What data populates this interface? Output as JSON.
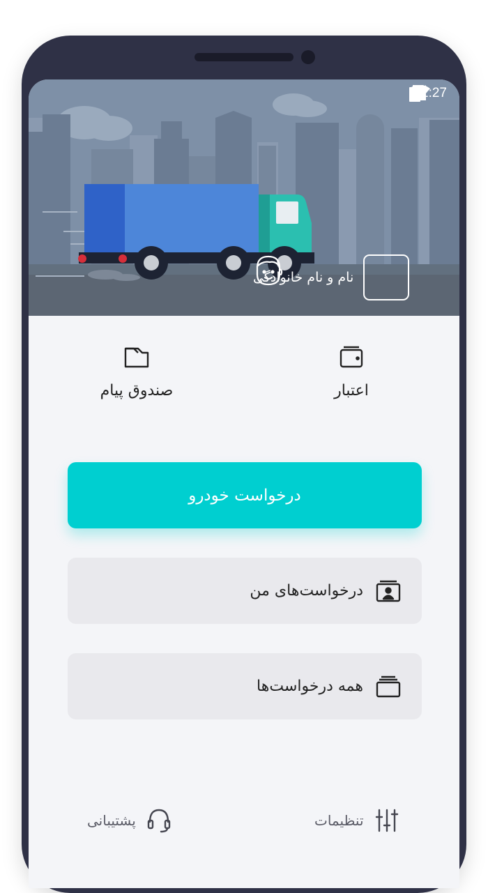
{
  "status_bar": {
    "time": "12:27",
    "icons": [
      "wifi-icon",
      "signal-icon",
      "battery-icon"
    ]
  },
  "profile": {
    "name": "نام و نام خانوادگی",
    "avatar_icon": "face-icon"
  },
  "quick_actions": {
    "inbox": {
      "label": "صندوق پیام",
      "icon": "folder-icon"
    },
    "credit": {
      "label": "اعتبار",
      "icon": "wallet-icon"
    }
  },
  "actions": {
    "request_vehicle": "درخواست خودرو",
    "my_requests": "درخواست‌های من",
    "all_requests": "همه درخواست‌ها"
  },
  "bottom_bar": {
    "support": "پشتیبانی",
    "settings": "تنظیمات"
  },
  "colors": {
    "accent": "#00cfd0",
    "frame": "#2f3146",
    "background": "#f4f5f8",
    "card": "#e9e9ed"
  }
}
